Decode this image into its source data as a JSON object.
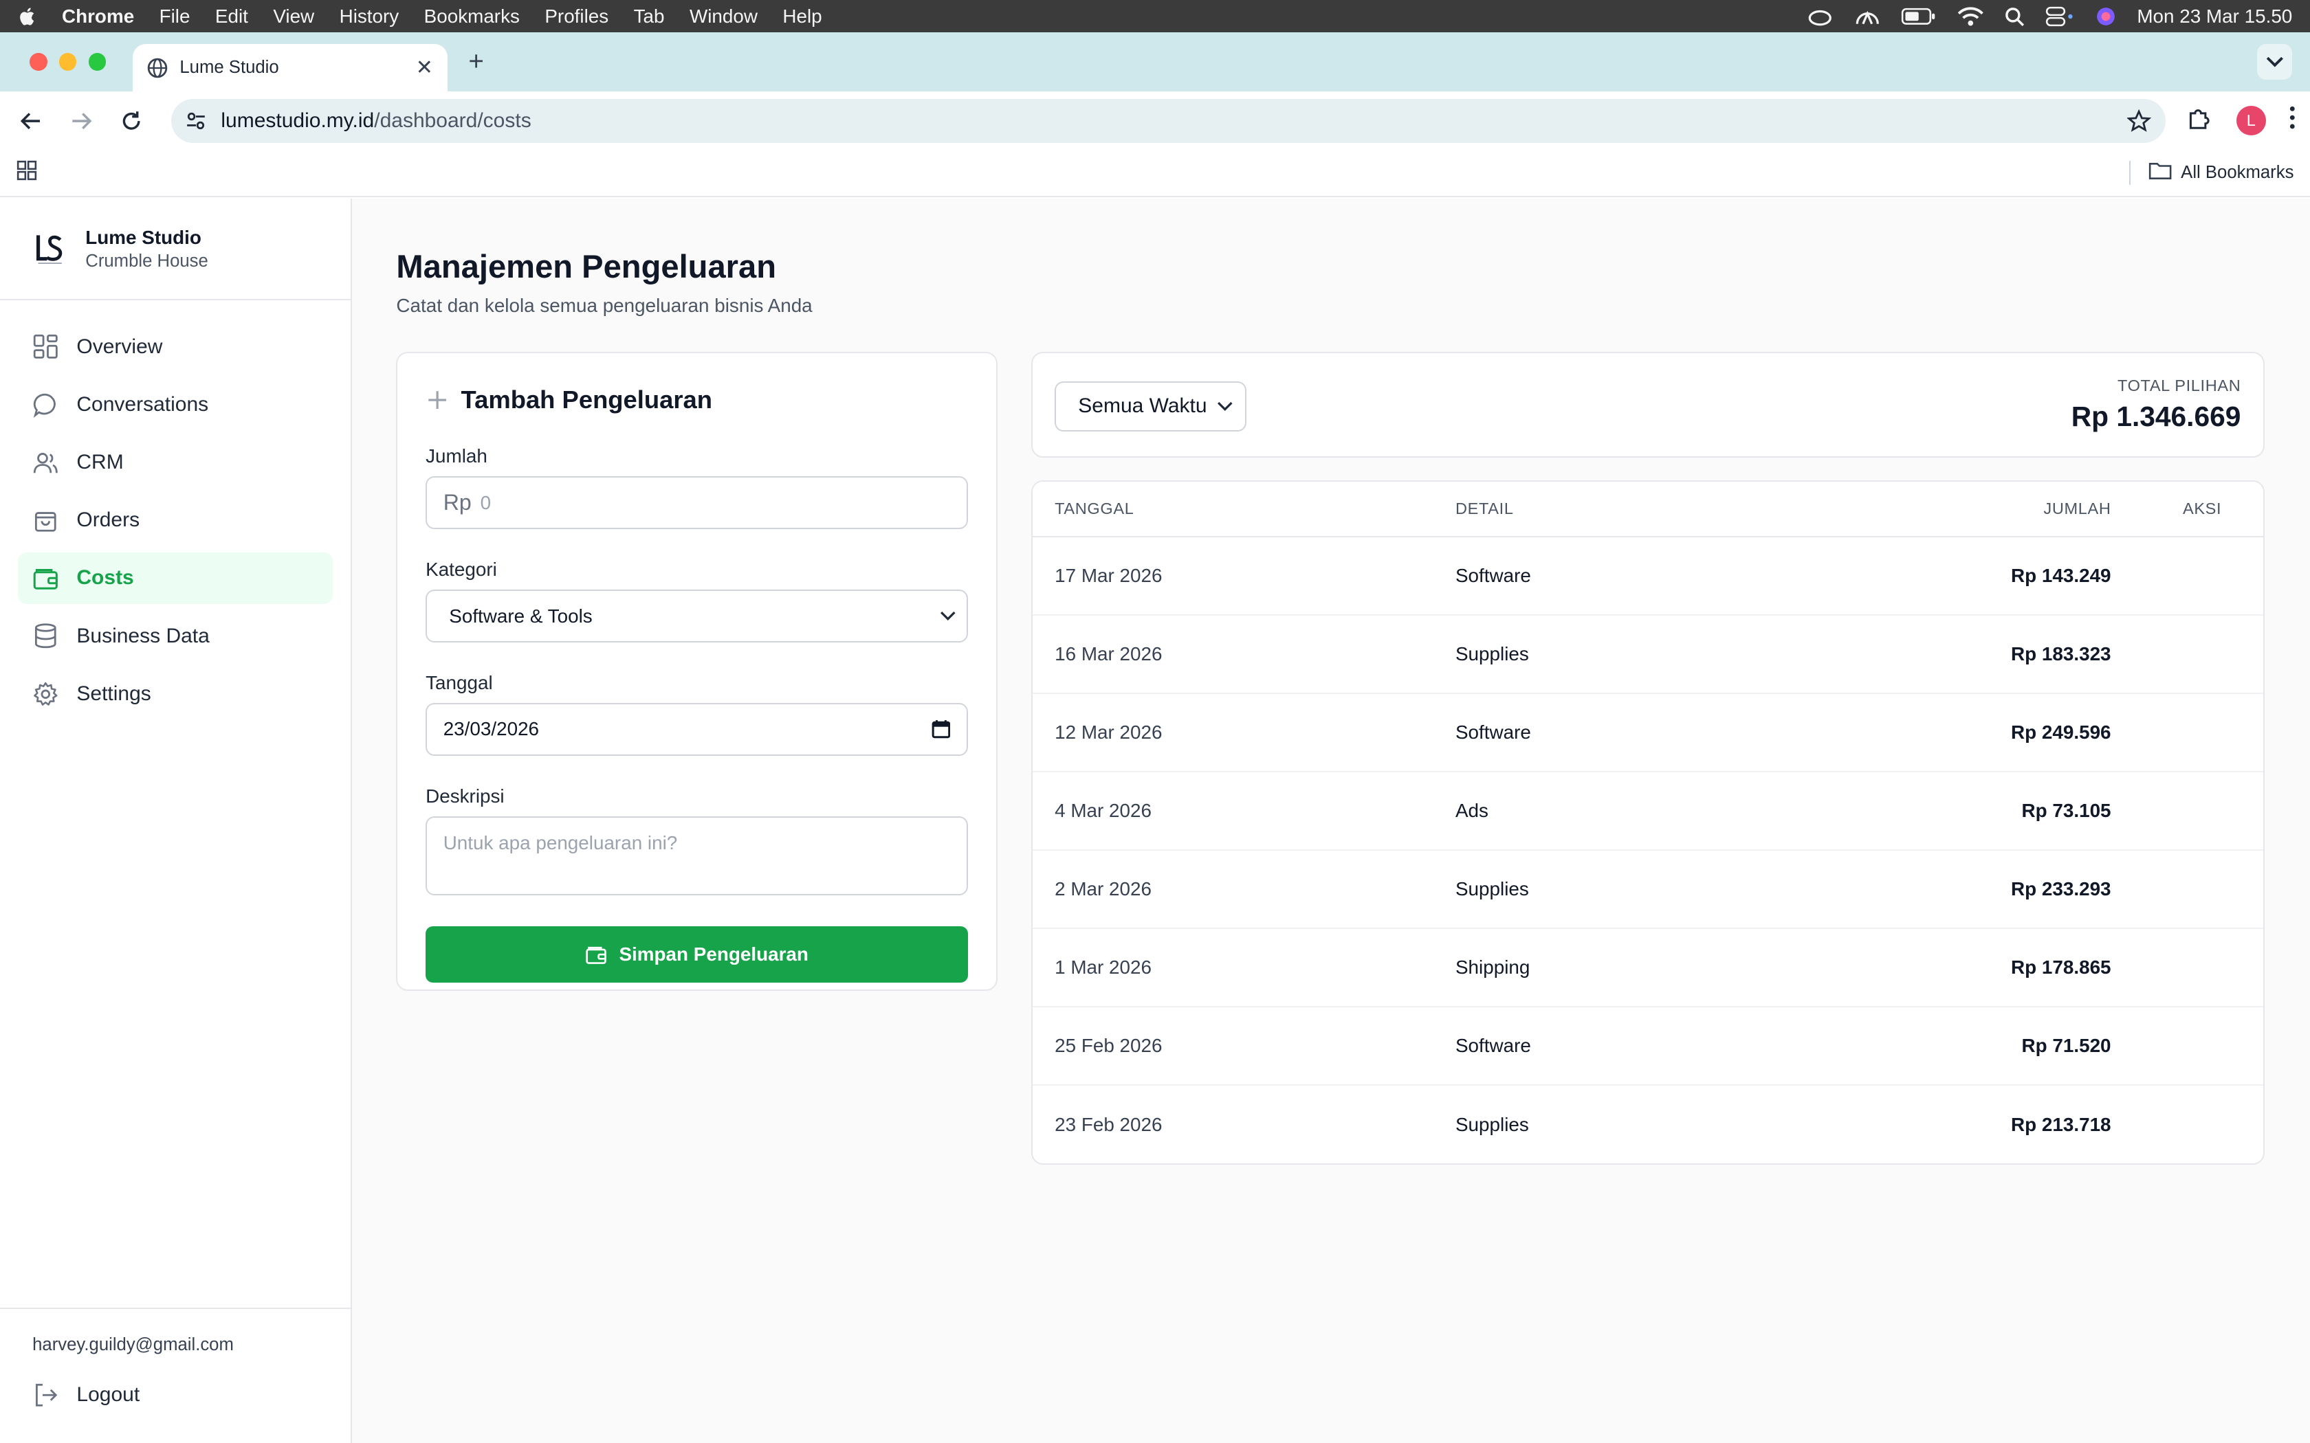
{
  "menubar": {
    "app": "Chrome",
    "items": [
      "File",
      "Edit",
      "View",
      "History",
      "Bookmarks",
      "Profiles",
      "Tab",
      "Window",
      "Help"
    ],
    "clock": "Mon 23 Mar  15.50"
  },
  "browser": {
    "tab_title": "Lume Studio",
    "url_host": "lumestudio.my.id",
    "url_path": "/dashboard/costs",
    "profile_initial": "L",
    "all_bookmarks": "All Bookmarks",
    "colors": {
      "close": "#fe5f57",
      "minimize": "#febc2e",
      "maximize": "#28c840",
      "tab_strip": "#cfe8ec"
    }
  },
  "sidebar": {
    "brand_name": "Lume Studio",
    "brand_sub": "Crumble House",
    "items": [
      {
        "label": "Overview",
        "icon": "grid-icon"
      },
      {
        "label": "Conversations",
        "icon": "chat-bubble-icon"
      },
      {
        "label": "CRM",
        "icon": "users-icon"
      },
      {
        "label": "Orders",
        "icon": "shopping-bag-icon"
      },
      {
        "label": "Costs",
        "icon": "wallet-icon",
        "active": true
      },
      {
        "label": "Business Data",
        "icon": "database-icon"
      },
      {
        "label": "Settings",
        "icon": "gear-icon"
      }
    ],
    "email": "harvey.guildy@gmail.com",
    "logout": "Logout"
  },
  "page": {
    "title": "Manajemen Pengeluaran",
    "subtitle": "Catat dan kelola semua pengeluaran bisnis Anda"
  },
  "form": {
    "heading": "Tambah Pengeluaran",
    "amount_label": "Jumlah",
    "amount_prefix": "Rp",
    "amount_placeholder": "0",
    "category_label": "Kategori",
    "category_value": "Software & Tools",
    "date_label": "Tanggal",
    "date_value": "23/03/2026",
    "description_label": "Deskripsi",
    "description_placeholder": "Untuk apa pengeluaran ini?",
    "save_label": "Simpan Pengeluaran",
    "accent": "#16a34a"
  },
  "filter": {
    "period": "Semua Waktu",
    "total_label": "TOTAL PILIHAN",
    "total_value": "Rp 1.346.669"
  },
  "table": {
    "headers": {
      "date": "TANGGAL",
      "detail": "DETAIL",
      "amount": "JUMLAH",
      "action": "AKSI"
    },
    "rows": [
      {
        "date": "17 Mar 2026",
        "detail": "Software",
        "amount": "Rp 143.249"
      },
      {
        "date": "16 Mar 2026",
        "detail": "Supplies",
        "amount": "Rp 183.323"
      },
      {
        "date": "12 Mar 2026",
        "detail": "Software",
        "amount": "Rp 249.596"
      },
      {
        "date": "4 Mar 2026",
        "detail": "Ads",
        "amount": "Rp 73.105"
      },
      {
        "date": "2 Mar 2026",
        "detail": "Supplies",
        "amount": "Rp 233.293"
      },
      {
        "date": "1 Mar 2026",
        "detail": "Shipping",
        "amount": "Rp 178.865"
      },
      {
        "date": "25 Feb 2026",
        "detail": "Software",
        "amount": "Rp 71.520"
      },
      {
        "date": "23 Feb 2026",
        "detail": "Supplies",
        "amount": "Rp 213.718"
      }
    ]
  }
}
